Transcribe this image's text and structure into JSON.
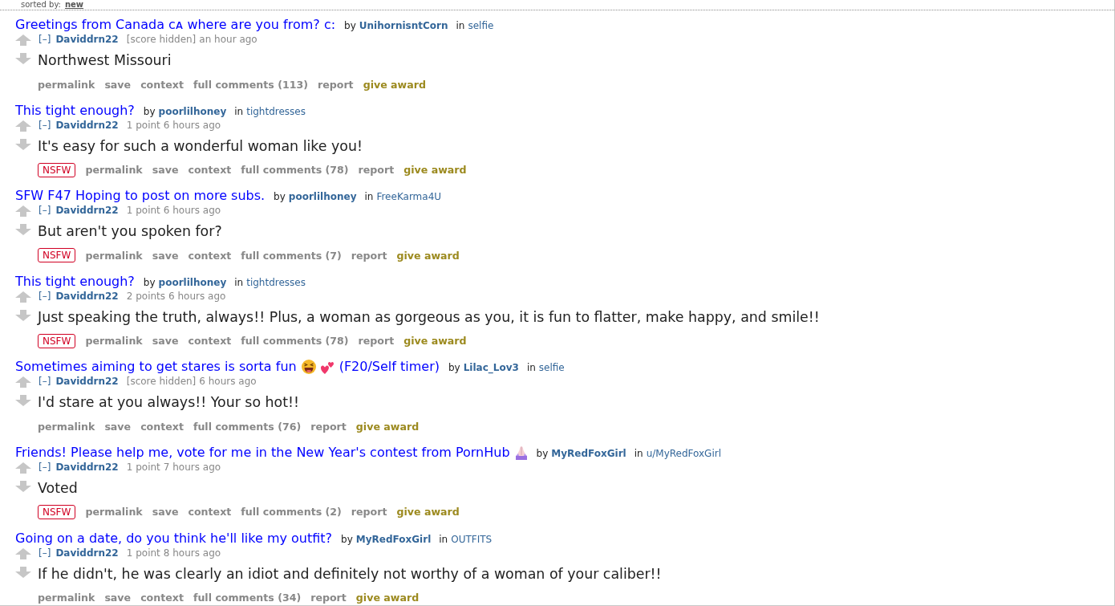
{
  "sort_bar": {
    "label": "sorted by:",
    "value": "new"
  },
  "comments": [
    {
      "post_title": [
        {
          "kind": "text",
          "text": "Greetings from Canada ᴄᴀ where are you from? c:"
        }
      ],
      "by_label": "by",
      "post_author": "UnihornisntCorn",
      "in_label": "in",
      "subreddit": "selfie",
      "collapse": "[–]",
      "author": "Daviddrn22",
      "score": "[score hidden]",
      "time": "an hour ago",
      "body": "Northwest Missouri",
      "buttons": [
        {
          "kind": "link",
          "label": "permalink"
        },
        {
          "kind": "link",
          "label": "save"
        },
        {
          "kind": "link",
          "label": "context"
        },
        {
          "kind": "link",
          "label": "full comments (113)"
        },
        {
          "kind": "link",
          "label": "report"
        },
        {
          "kind": "award",
          "label": "give award"
        }
      ]
    },
    {
      "post_title": [
        {
          "kind": "text",
          "text": "This tight enough?"
        }
      ],
      "by_label": "by",
      "post_author": "poorlilhoney",
      "in_label": "in",
      "subreddit": "tightdresses",
      "collapse": "[–]",
      "author": "Daviddrn22",
      "score": "1 point",
      "time": "6 hours ago",
      "body": "It's easy for such a wonderful woman like you!",
      "tags": [
        "NSFW"
      ],
      "buttons": [
        {
          "kind": "link",
          "label": "permalink"
        },
        {
          "kind": "link",
          "label": "save"
        },
        {
          "kind": "link",
          "label": "context"
        },
        {
          "kind": "link",
          "label": "full comments (78)"
        },
        {
          "kind": "link",
          "label": "report"
        },
        {
          "kind": "award",
          "label": "give award"
        }
      ]
    },
    {
      "post_title": [
        {
          "kind": "text",
          "text": "SFW F47 Hoping to post on more subs."
        }
      ],
      "by_label": "by",
      "post_author": "poorlilhoney",
      "in_label": "in",
      "subreddit": "FreeKarma4U",
      "collapse": "[–]",
      "author": "Daviddrn22",
      "score": "1 point",
      "time": "6 hours ago",
      "body": "But aren't you spoken for?",
      "tags": [
        "NSFW"
      ],
      "buttons": [
        {
          "kind": "link",
          "label": "permalink"
        },
        {
          "kind": "link",
          "label": "save"
        },
        {
          "kind": "link",
          "label": "context"
        },
        {
          "kind": "link",
          "label": "full comments (7)"
        },
        {
          "kind": "link",
          "label": "report"
        },
        {
          "kind": "award",
          "label": "give award"
        }
      ]
    },
    {
      "post_title": [
        {
          "kind": "text",
          "text": "This tight enough?"
        }
      ],
      "by_label": "by",
      "post_author": "poorlilhoney",
      "in_label": "in",
      "subreddit": "tightdresses",
      "collapse": "[–]",
      "author": "Daviddrn22",
      "score": "2 points",
      "time": "6 hours ago",
      "body": "Just speaking the truth, always!! Plus, a woman as gorgeous as you, it is fun to flatter, make happy, and smile!!",
      "tags": [
        "NSFW"
      ],
      "buttons": [
        {
          "kind": "link",
          "label": "permalink"
        },
        {
          "kind": "link",
          "label": "save"
        },
        {
          "kind": "link",
          "label": "context"
        },
        {
          "kind": "link",
          "label": "full comments (78)"
        },
        {
          "kind": "link",
          "label": "report"
        },
        {
          "kind": "award",
          "label": "give award"
        }
      ]
    },
    {
      "post_title": [
        {
          "kind": "text",
          "text": "Sometimes aiming to get stares is sorta fun"
        },
        {
          "kind": "laugh"
        },
        {
          "kind": "hearts"
        },
        {
          "kind": "text",
          "text": "(F20/Self timer)"
        }
      ],
      "by_label": "by",
      "post_author": "Lilac_Lov3",
      "in_label": "in",
      "subreddit": "selfie",
      "collapse": "[–]",
      "author": "Daviddrn22",
      "score": "[score hidden]",
      "time": "6 hours ago",
      "body": "I'd stare at you always!! Your so hot!!",
      "buttons": [
        {
          "kind": "link",
          "label": "permalink"
        },
        {
          "kind": "link",
          "label": "save"
        },
        {
          "kind": "link",
          "label": "context"
        },
        {
          "kind": "link",
          "label": "full comments (76)"
        },
        {
          "kind": "link",
          "label": "report"
        },
        {
          "kind": "award",
          "label": "give award"
        }
      ]
    },
    {
      "post_title": [
        {
          "kind": "text",
          "text": "Friends! Please help me, vote for me in the New Year's contest from PornHub"
        },
        {
          "kind": "hands"
        }
      ],
      "by_label": "by",
      "post_author": "MyRedFoxGirl",
      "in_label": "in",
      "subreddit": "u/MyRedFoxGirl",
      "collapse": "[–]",
      "author": "Daviddrn22",
      "score": "1 point",
      "time": "7 hours ago",
      "body": "Voted",
      "tags": [
        "NSFW"
      ],
      "buttons": [
        {
          "kind": "link",
          "label": "permalink"
        },
        {
          "kind": "link",
          "label": "save"
        },
        {
          "kind": "link",
          "label": "context"
        },
        {
          "kind": "link",
          "label": "full comments (2)"
        },
        {
          "kind": "link",
          "label": "report"
        },
        {
          "kind": "award",
          "label": "give award"
        }
      ]
    },
    {
      "post_title": [
        {
          "kind": "text",
          "text": "Going on a date, do you think he'll like my outfit?"
        }
      ],
      "by_label": "by",
      "post_author": "MyRedFoxGirl",
      "in_label": "in",
      "subreddit": "OUTFITS",
      "collapse": "[–]",
      "author": "Daviddrn22",
      "score": "1 point",
      "time": "8 hours ago",
      "body": "If he didn't, he was clearly an idiot and definitely not worthy of a woman of your caliber!!",
      "buttons": [
        {
          "kind": "link",
          "label": "permalink"
        },
        {
          "kind": "link",
          "label": "save"
        },
        {
          "kind": "link",
          "label": "context"
        },
        {
          "kind": "link",
          "label": "full comments (34)"
        },
        {
          "kind": "link",
          "label": "report"
        },
        {
          "kind": "award",
          "label": "give award"
        }
      ]
    }
  ]
}
